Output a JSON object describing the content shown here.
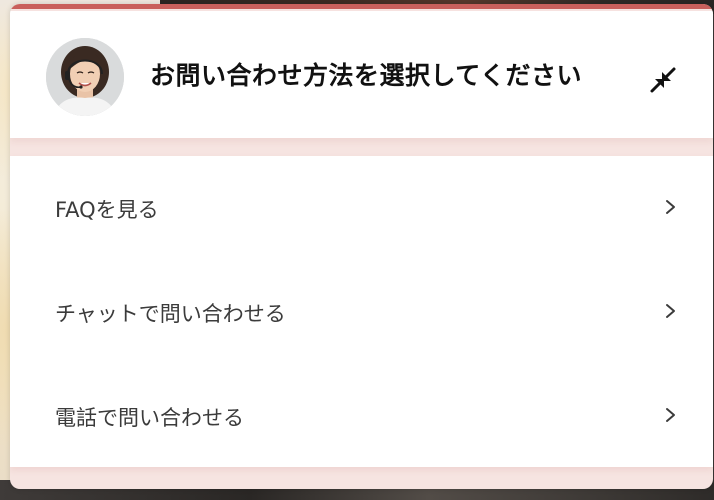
{
  "widget": {
    "header": {
      "title": "お問い合わせ方法を選択してください",
      "avatar_icon": "operator-avatar",
      "minimize_icon": "minimize-arrows-icon"
    },
    "menu": {
      "items": [
        {
          "label": "FAQを見る",
          "icon": "chevron-right-icon"
        },
        {
          "label": "チャットで問い合わせる",
          "icon": "chevron-right-icon"
        },
        {
          "label": "電話で問い合わせる",
          "icon": "chevron-right-icon"
        }
      ]
    }
  },
  "colors": {
    "accent": "#c9605c",
    "panel_tint": "#f6e4e1",
    "text": "#3b3b3b",
    "title": "#111111"
  }
}
